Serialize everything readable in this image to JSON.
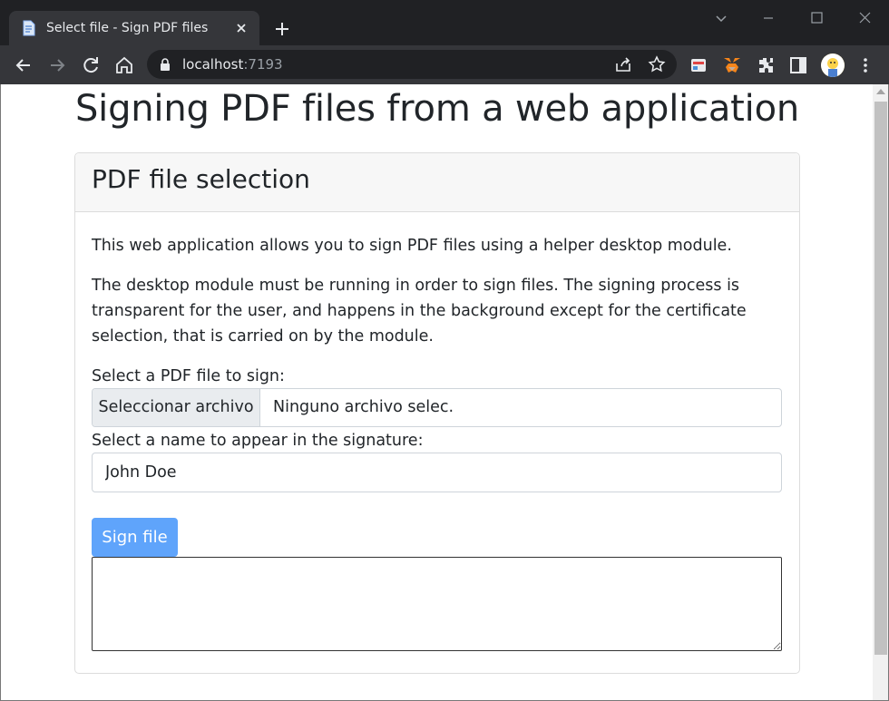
{
  "browser": {
    "tab_title": "Select file - Sign PDF files",
    "url_host": "localhost",
    "url_port": ":7193"
  },
  "page": {
    "heading": "Signing PDF files from a web application",
    "card": {
      "title": "PDF file selection",
      "paragraph1": "This web application allows you to sign PDF files using a helper desktop module.",
      "paragraph2": "The desktop module must be running in order to sign files. The signing process is transparent for the user, and happens in the background except for the certificate selection, that is carried on by the module.",
      "file_label": "Select a PDF file to sign:",
      "file_button": "Seleccionar archivo",
      "file_status": "Ninguno archivo selec.",
      "name_label": "Select a name to appear in the signature:",
      "name_value": "John Doe",
      "sign_button": "Sign file",
      "output_value": ""
    }
  },
  "colors": {
    "chrome_dark": "#202124",
    "toolbar": "#35363a",
    "primary_button": "#5fa4fb"
  },
  "icons": [
    "file-favicon-icon",
    "close-icon",
    "plus-icon",
    "back-icon",
    "forward-icon",
    "reload-icon",
    "home-icon",
    "lock-icon",
    "share-icon",
    "star-icon",
    "extension-icon",
    "metamask-icon",
    "puzzle-icon",
    "sidepanel-icon",
    "avatar",
    "kebab-menu-icon"
  ]
}
